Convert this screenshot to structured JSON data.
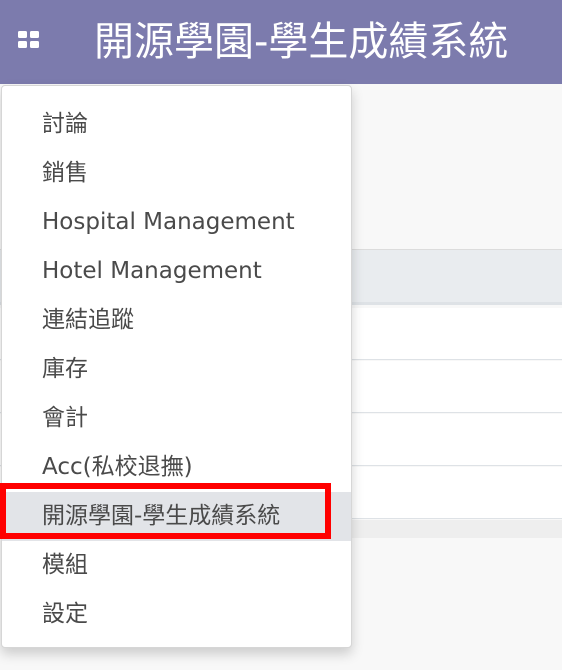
{
  "navbar": {
    "apps_icon": "grid-icon",
    "title": "開源學園-學生成績系統",
    "color": "#7c7bad"
  },
  "menu": {
    "items": [
      {
        "label": "討論"
      },
      {
        "label": "銷售"
      },
      {
        "label": "Hospital Management"
      },
      {
        "label": "Hotel Management"
      },
      {
        "label": "連結追蹤"
      },
      {
        "label": "庫存"
      },
      {
        "label": "會計"
      },
      {
        "label": "Acc(私校退撫)"
      },
      {
        "label": "開源學園-學生成績系統",
        "active": true
      },
      {
        "label": "模組"
      },
      {
        "label": "設定"
      }
    ]
  },
  "annotation": {
    "highlight_color": "#ff0000"
  }
}
